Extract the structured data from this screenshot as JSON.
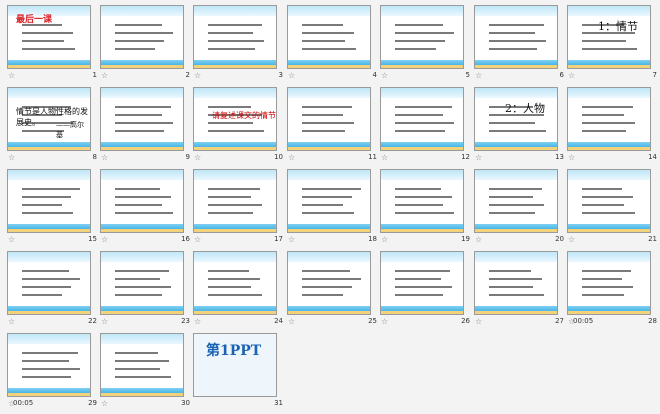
{
  "slides": [
    {
      "n": "1",
      "text": "最后一课",
      "star": true
    },
    {
      "n": "2",
      "text": "",
      "star": true
    },
    {
      "n": "3",
      "text": "",
      "star": true
    },
    {
      "n": "4",
      "text": "",
      "star": true
    },
    {
      "n": "5",
      "text": "",
      "star": true
    },
    {
      "n": "6",
      "text": "",
      "star": true
    },
    {
      "n": "7",
      "text": "1：情节",
      "star": true
    },
    {
      "n": "8",
      "text": "情节是人物性格的发展史。",
      "sub": "——高尔基",
      "star": true
    },
    {
      "n": "9",
      "text": "",
      "star": true
    },
    {
      "n": "10",
      "text": "请复述课文的情节",
      "star": true
    },
    {
      "n": "11",
      "text": "",
      "star": true
    },
    {
      "n": "12",
      "text": "",
      "star": true
    },
    {
      "n": "13",
      "text": "2：人物",
      "star": true
    },
    {
      "n": "14",
      "text": "",
      "star": true
    },
    {
      "n": "15",
      "text": "",
      "star": true
    },
    {
      "n": "16",
      "text": "",
      "star": true
    },
    {
      "n": "17",
      "text": "",
      "star": true
    },
    {
      "n": "18",
      "text": "",
      "star": true
    },
    {
      "n": "19",
      "text": "",
      "star": true
    },
    {
      "n": "20",
      "text": "",
      "star": true
    },
    {
      "n": "21",
      "text": "",
      "star": true
    },
    {
      "n": "22",
      "text": "",
      "star": true
    },
    {
      "n": "23",
      "text": "",
      "star": true
    },
    {
      "n": "24",
      "text": "",
      "star": true
    },
    {
      "n": "25",
      "text": "",
      "star": true
    },
    {
      "n": "26",
      "text": "",
      "star": true
    },
    {
      "n": "27",
      "text": "",
      "star": true
    },
    {
      "n": "28",
      "text": "",
      "time": "00:05",
      "star": true
    },
    {
      "n": "29",
      "text": "",
      "time": "00:05",
      "star": true
    },
    {
      "n": "30",
      "text": "",
      "star": true
    },
    {
      "n": "31",
      "text": "第1PPT",
      "star": false
    }
  ]
}
